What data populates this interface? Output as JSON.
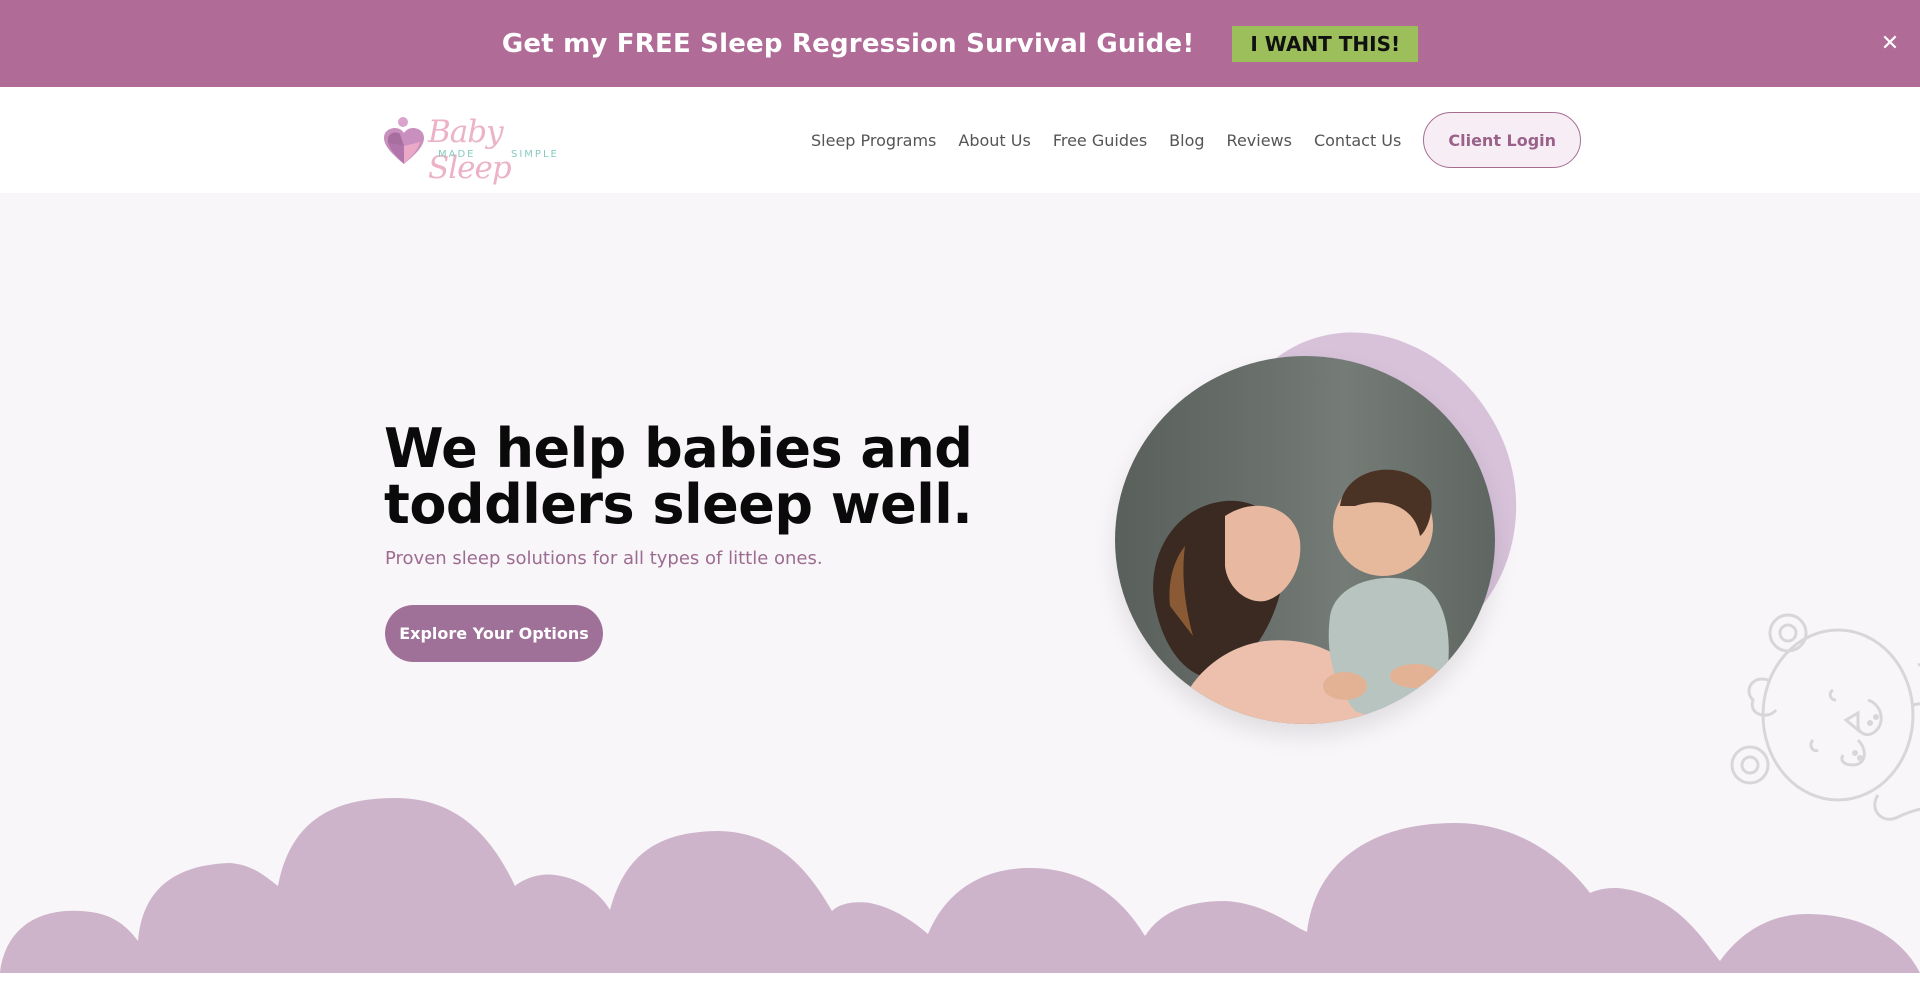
{
  "promo": {
    "text": "Get my FREE Sleep Regression Survival Guide!",
    "cta_label": "I WANT THIS!",
    "close_icon": "close-icon",
    "background_color": "#b06b96",
    "cta_color": "#9cbf5c"
  },
  "header": {
    "logo": {
      "name": "Baby Sleep",
      "sub_left": "MADE",
      "sub_right": "SIMPLE",
      "icon": "heart-logo-icon"
    },
    "nav": [
      {
        "label": "Sleep Programs"
      },
      {
        "label": "About Us"
      },
      {
        "label": "Free Guides"
      },
      {
        "label": "Blog"
      },
      {
        "label": "Reviews"
      },
      {
        "label": "Contact Us"
      }
    ],
    "client_login_label": "Client Login"
  },
  "hero": {
    "title_line1": "We help babies and",
    "title_line2": "toddlers sleep well.",
    "subtitle": "Proven sleep solutions for all types of little ones.",
    "cta_label": "Explore Your Options",
    "image_alt": "Mother smiling and holding her toddler son",
    "accent_color": "#a07198",
    "cloud_color": "#cdb4ca",
    "decoration": "teddy-bear-outline-icon"
  }
}
